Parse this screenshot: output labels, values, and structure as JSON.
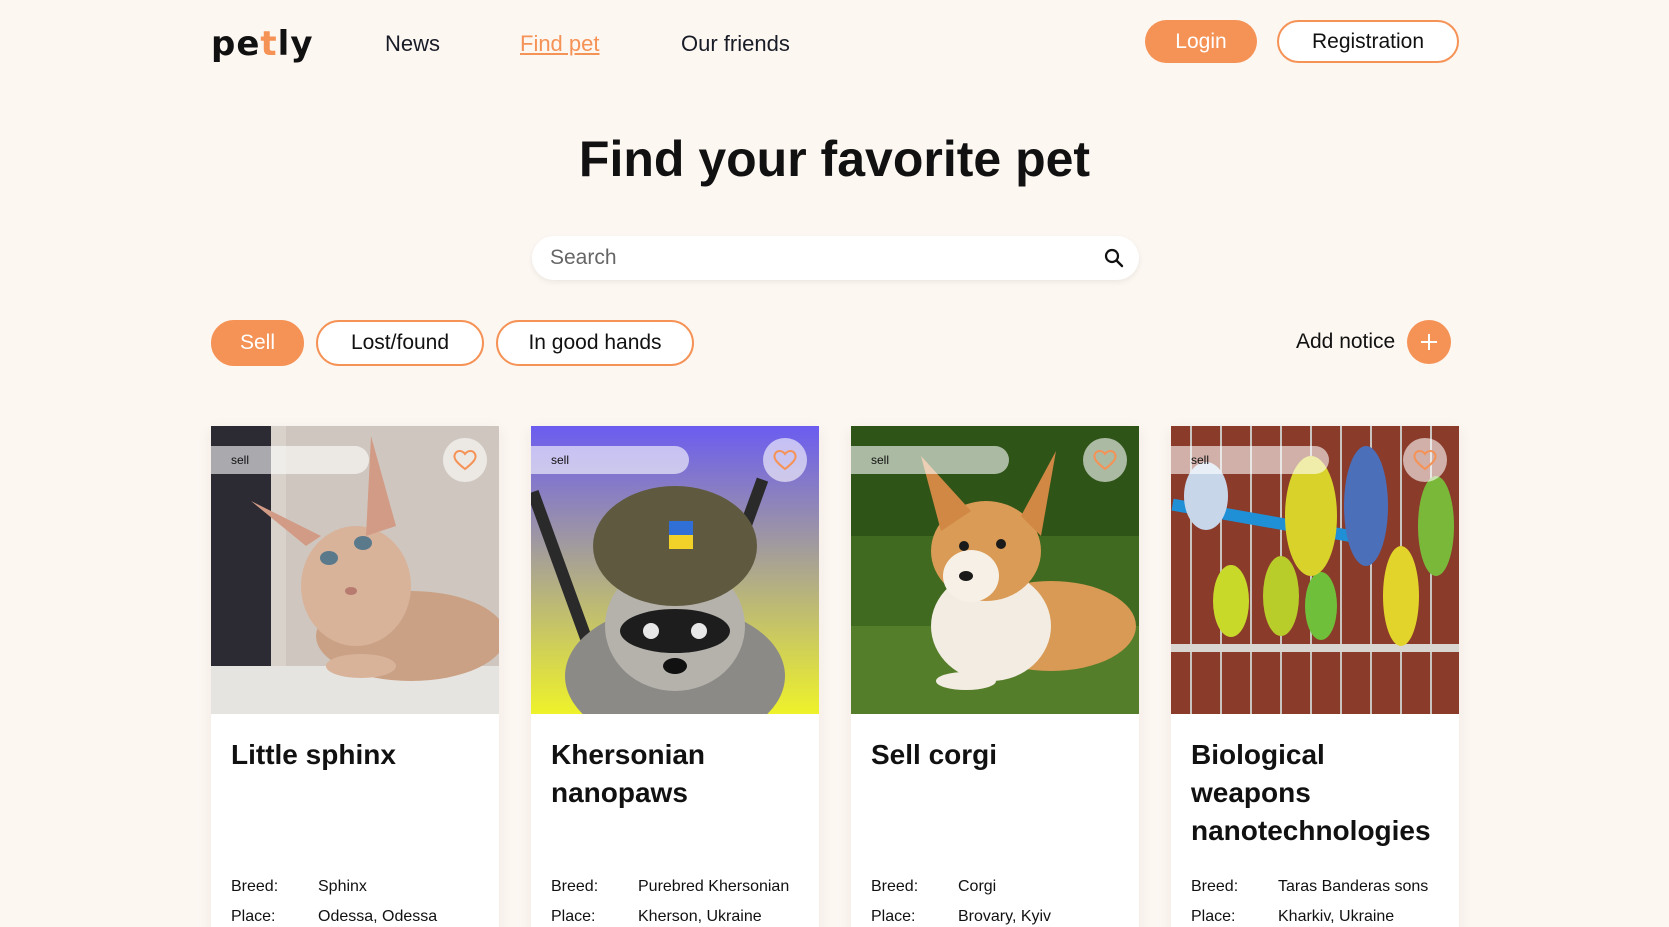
{
  "header": {
    "logo_pre": "pe",
    "logo_accent": "t",
    "logo_post": "ly",
    "nav": [
      {
        "label": "News"
      },
      {
        "label": "Find pet"
      },
      {
        "label": "Our friends"
      }
    ],
    "login_label": "Login",
    "registration_label": "Registration"
  },
  "main": {
    "title": "Find your favorite pet",
    "search": {
      "placeholder": "Search",
      "value": ""
    },
    "filters": [
      {
        "label": "Sell",
        "active": true
      },
      {
        "label": "Lost/found",
        "active": false
      },
      {
        "label": "In good hands",
        "active": false
      }
    ],
    "add_notice_label": "Add notice"
  },
  "cards": [
    {
      "tag": "sell",
      "title": "Little sphinx",
      "breed_label": "Breed:",
      "breed": "Sphinx",
      "place_label": "Place:",
      "place": "Odessa, Odessa"
    },
    {
      "tag": "sell",
      "title": "Khersonian nanopaws",
      "breed_label": "Breed:",
      "breed": "Purebred Khersonian",
      "place_label": "Place:",
      "place": "Kherson, Ukraine"
    },
    {
      "tag": "sell",
      "title": "Sell corgi",
      "breed_label": "Breed:",
      "breed": "Corgi",
      "place_label": "Place:",
      "place": "Brovary, Kyiv"
    },
    {
      "tag": "sell",
      "title": "Biological weapons nanotechnologies",
      "breed_label": "Breed:",
      "breed": "Taras Banderas sons",
      "place_label": "Place:",
      "place": "Kharkiv, Ukraine"
    }
  ],
  "colors": {
    "accent": "#F59256",
    "background": "#FDF7F2"
  }
}
